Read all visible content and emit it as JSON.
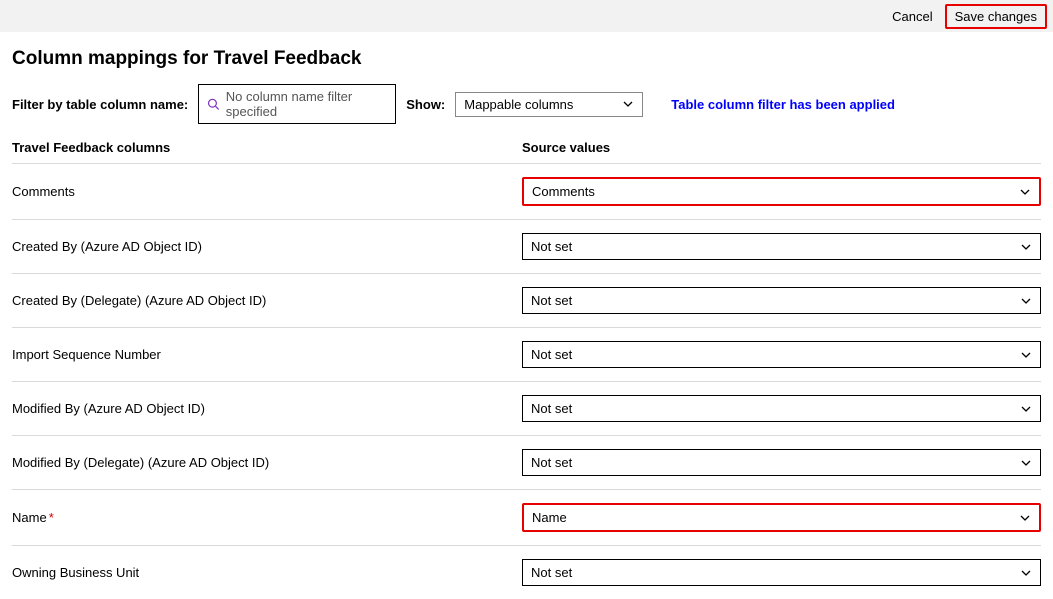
{
  "toolbar": {
    "cancel": "Cancel",
    "save": "Save changes"
  },
  "page_title": "Column mappings for Travel Feedback",
  "filters": {
    "filter_label": "Filter by table column name:",
    "filter_placeholder": "No column name filter specified",
    "show_label": "Show:",
    "show_value": "Mappable columns",
    "applied_message": "Table column filter has been applied"
  },
  "table": {
    "col_a_header": "Travel Feedback columns",
    "col_b_header": "Source values",
    "rows": [
      {
        "name": "Comments",
        "required": false,
        "value": "Comments",
        "highlight": true
      },
      {
        "name": "Created By (Azure AD Object ID)",
        "required": false,
        "value": "Not set",
        "highlight": false
      },
      {
        "name": "Created By (Delegate) (Azure AD Object ID)",
        "required": false,
        "value": "Not set",
        "highlight": false
      },
      {
        "name": "Import Sequence Number",
        "required": false,
        "value": "Not set",
        "highlight": false
      },
      {
        "name": "Modified By (Azure AD Object ID)",
        "required": false,
        "value": "Not set",
        "highlight": false
      },
      {
        "name": "Modified By (Delegate) (Azure AD Object ID)",
        "required": false,
        "value": "Not set",
        "highlight": false
      },
      {
        "name": "Name",
        "required": true,
        "value": "Name",
        "highlight": true
      },
      {
        "name": "Owning Business Unit",
        "required": false,
        "value": "Not set",
        "highlight": false
      }
    ]
  }
}
